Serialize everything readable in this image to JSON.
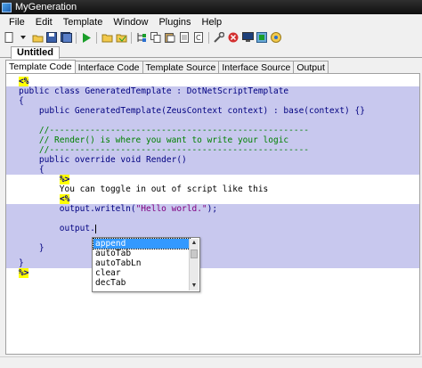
{
  "window": {
    "title": "MyGeneration"
  },
  "menu": [
    "File",
    "Edit",
    "Template",
    "Window",
    "Plugins",
    "Help"
  ],
  "toolbar_icons": [
    "new-icon",
    "open-icon",
    "save-icon",
    "save-all-icon",
    "run-icon",
    "open-folder-icon",
    "compile-icon",
    "tree-icon",
    "copy-icon",
    "paste-icon",
    "cut-icon",
    "page-icon",
    "tools-icon",
    "stop-icon",
    "monitor-icon",
    "settings-icon",
    "help-icon"
  ],
  "document_tab": "Untitled",
  "subtabs": [
    "Template Code",
    "Interface Code",
    "Template Source",
    "Interface Source",
    "Output"
  ],
  "code": {
    "l01": "<%",
    "l02a": "public class ",
    "l02b": "GeneratedTemplate : DotNetScriptTemplate",
    "l03": "{",
    "l04a": "    public ",
    "l04b": "GeneratedTemplate(ZeusContext context) : base(context) {}",
    "l05": "",
    "l06": "    //---------------------------------------------------",
    "l07": "    // Render() is where you want to write your logic",
    "l08": "    //---------------------------------------------------",
    "l09a": "    public override void ",
    "l09b": "Render()",
    "l10": "    {",
    "l11": "%>",
    "l12": "        You can toggle in out of script like this",
    "l13": "<%",
    "l14a": "        output.writeln(",
    "l14b": "\"Hello world.\"",
    "l14c": ");",
    "l15": "",
    "l16": "        output.",
    "l17": "",
    "l18": "    }",
    "l19": "",
    "l20": "}",
    "l21": "%>"
  },
  "autocomplete": {
    "items": [
      "append",
      "autoTab",
      "autoTabLn",
      "clear",
      "decTab"
    ],
    "selected": "append"
  }
}
